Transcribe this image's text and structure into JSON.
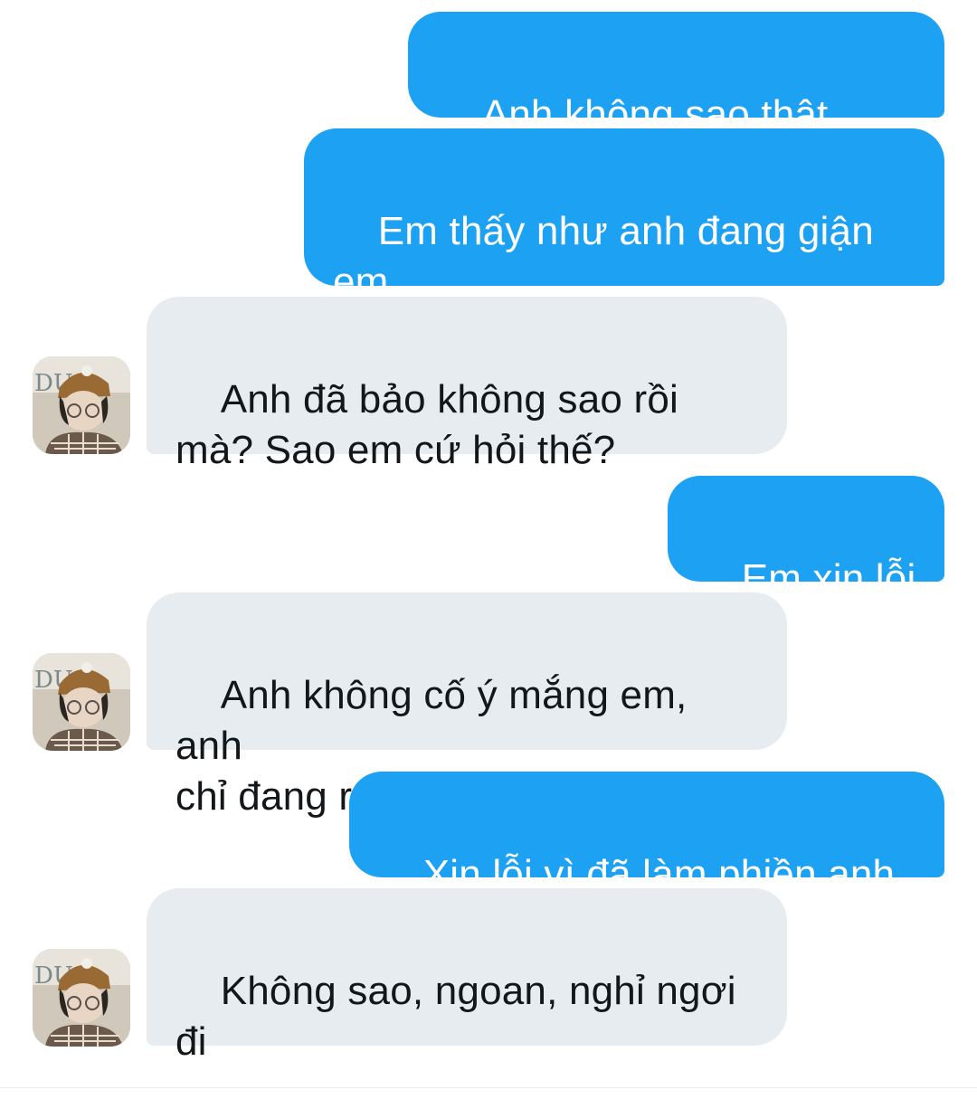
{
  "conversation": {
    "messages": [
      {
        "direction": "sent",
        "text": "Anh không sao thật chứ?"
      },
      {
        "direction": "sent",
        "text": "Em thấy như anh đang giận\nem"
      },
      {
        "direction": "received",
        "text": "Anh đã bảo không sao rồi\nmà? Sao em cứ hỏi thế?"
      },
      {
        "direction": "sent",
        "text": "Em xin lỗi ạ"
      },
      {
        "direction": "received",
        "text": "Anh không cố ý mắng em, anh\nchỉ đang rất mệt thôi"
      },
      {
        "direction": "sent",
        "text": "Xin lỗi vì đã làm phiền anh ạ"
      },
      {
        "direction": "received",
        "text": "Không sao, ngoan, nghỉ ngơi\nđi"
      }
    ]
  },
  "colors": {
    "sent_bubble": "#1da1f2",
    "received_bubble": "#e6ecf0",
    "received_text": "#14171a"
  },
  "icons": {
    "avatar": "user-avatar-photo"
  }
}
